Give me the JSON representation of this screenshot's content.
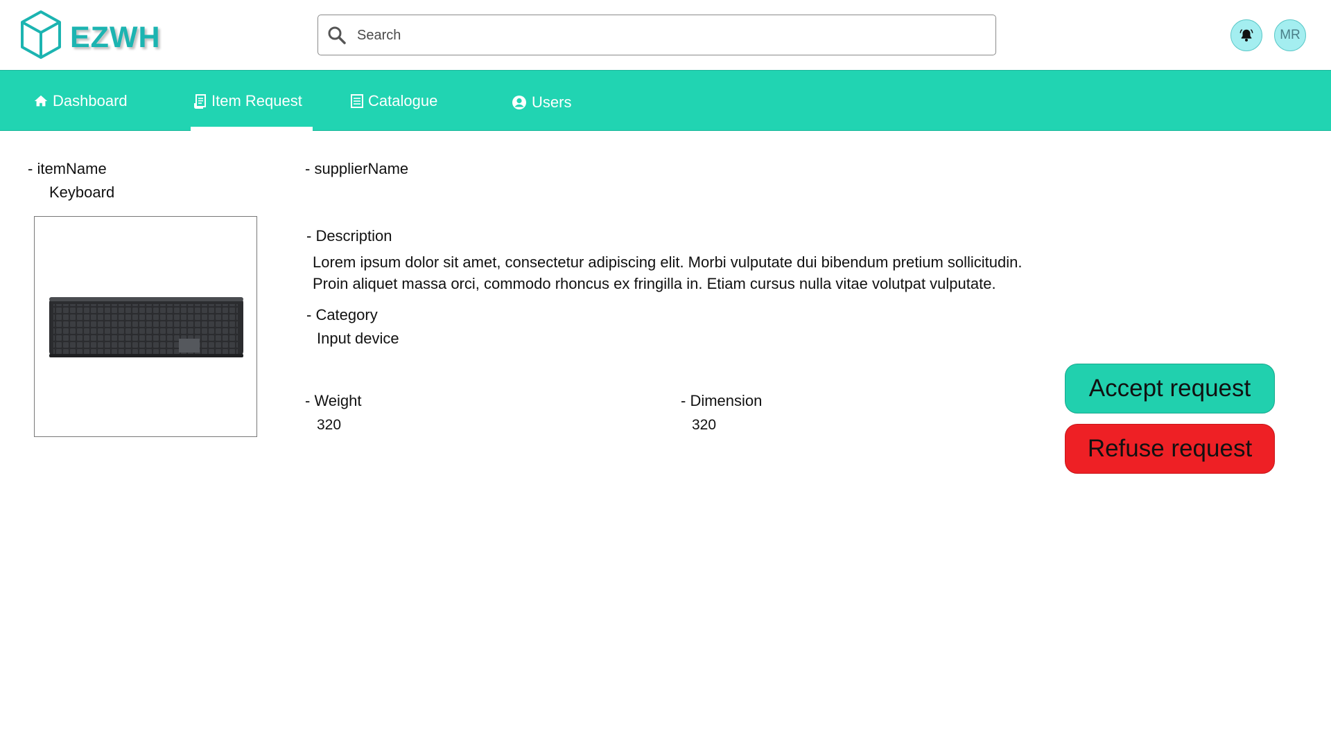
{
  "header": {
    "brand": "EZWH",
    "search_placeholder": "Search",
    "avatar_initials": "MR",
    "colors": {
      "brand": "#1cb4b1",
      "accent": "#21d4b2",
      "avatar_bg": "#a4eef0"
    }
  },
  "nav": {
    "items": [
      {
        "label": "Dashboard",
        "icon": "home-icon"
      },
      {
        "label": "Item Request",
        "icon": "receipt-icon",
        "active": true
      },
      {
        "label": "Catalogue",
        "icon": "list-icon"
      },
      {
        "label": "Users",
        "icon": "user-circle-icon"
      }
    ]
  },
  "item": {
    "name_label": "- itemName",
    "name_value": "Keyboard",
    "supplier_label": "- supplierName",
    "description_label": "- Description",
    "description_line1": "Lorem ipsum dolor sit amet, consectetur adipiscing elit. Morbi vulputate dui bibendum pretium sollicitudin.",
    "description_line2": "Proin aliquet massa orci, commodo rhoncus ex fringilla in. Etiam cursus nulla vitae volutpat vulputate.",
    "category_label": "- Category",
    "category_value": "Input device",
    "weight_label": "- Weight",
    "weight_value": "320",
    "dimension_label": "- Dimension",
    "dimension_value": "320",
    "image_icon": "keyboard-image"
  },
  "actions": {
    "accept_label": "Accept request",
    "refuse_label": "Refuse request",
    "accept_color": "#21d0ae",
    "refuse_color": "#ee2025"
  }
}
